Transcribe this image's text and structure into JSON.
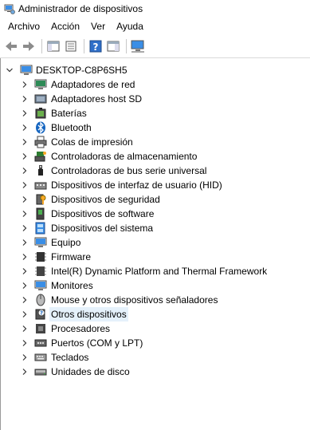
{
  "window": {
    "title": "Administrador de dispositivos"
  },
  "menu": [
    "Archivo",
    "Acción",
    "Ver",
    "Ayuda"
  ],
  "toolbar": {
    "buttons": [
      "back-icon",
      "forward-icon",
      "properties-icon",
      "show-hide-console-tree-icon",
      "help-icon",
      "action-pane-icon",
      "monitor-icon"
    ]
  },
  "tree": {
    "root": "DESKTOP-C8P6SH5",
    "items": [
      {
        "label": "Adaptadores de red",
        "icon": "network-adapter-icon"
      },
      {
        "label": "Adaptadores host SD",
        "icon": "sd-host-icon"
      },
      {
        "label": "Baterías",
        "icon": "battery-icon"
      },
      {
        "label": "Bluetooth",
        "icon": "bluetooth-icon"
      },
      {
        "label": "Colas de impresión",
        "icon": "printer-icon"
      },
      {
        "label": "Controladoras de almacenamiento",
        "icon": "storage-controller-icon"
      },
      {
        "label": "Controladoras de bus serie universal",
        "icon": "usb-icon"
      },
      {
        "label": "Dispositivos de interfaz de usuario (HID)",
        "icon": "hid-icon"
      },
      {
        "label": "Dispositivos de seguridad",
        "icon": "security-device-icon"
      },
      {
        "label": "Dispositivos de software",
        "icon": "software-device-icon"
      },
      {
        "label": "Dispositivos del sistema",
        "icon": "system-device-icon"
      },
      {
        "label": "Equipo",
        "icon": "computer-icon"
      },
      {
        "label": "Firmware",
        "icon": "firmware-icon"
      },
      {
        "label": "Intel(R) Dynamic Platform and Thermal Framework",
        "icon": "chip-icon"
      },
      {
        "label": "Monitores",
        "icon": "monitor-icon"
      },
      {
        "label": "Mouse y otros dispositivos señaladores",
        "icon": "mouse-icon"
      },
      {
        "label": "Otros dispositivos",
        "icon": "unknown-device-icon",
        "selected": true
      },
      {
        "label": "Procesadores",
        "icon": "processor-icon"
      },
      {
        "label": "Puertos (COM y LPT)",
        "icon": "port-icon"
      },
      {
        "label": "Teclados",
        "icon": "keyboard-icon"
      },
      {
        "label": "Unidades de disco",
        "icon": "disk-drive-icon"
      }
    ]
  },
  "colors": {
    "selection": "#e5f1fb",
    "accent": "#0078d7"
  }
}
